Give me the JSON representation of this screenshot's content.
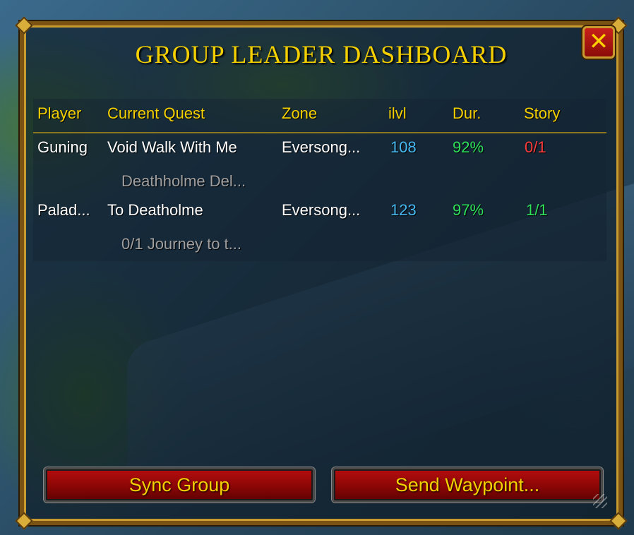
{
  "window": {
    "title": "GROUP LEADER DASHBOARD",
    "close_label": "✕"
  },
  "table": {
    "headers": [
      "Player",
      "Current Quest",
      "Zone",
      "ilvl",
      "Dur.",
      "Story"
    ],
    "rows": [
      {
        "player": "Guning",
        "quest": "Void Walk With Me",
        "zone": "Eversong...",
        "ilvl": "108",
        "dur": "92%",
        "story": "0/1",
        "sub": "Deathholme Del..."
      },
      {
        "player": "Palad...",
        "quest": "To Deatholme",
        "zone": "Eversong...",
        "ilvl": "123",
        "dur": "97%",
        "story": "1/1",
        "sub": "0/1 Journey to t..."
      }
    ]
  },
  "buttons": {
    "sync": "Sync Group",
    "waypoint": "Send Waypoint..."
  },
  "colors": {
    "title": "#f5d000",
    "ilvl": "#45b8f0",
    "durability": "#2ee05a",
    "story_incomplete": "#ff3b3b",
    "story_complete": "#2ee05a",
    "subtext": "#a0a0a0"
  }
}
